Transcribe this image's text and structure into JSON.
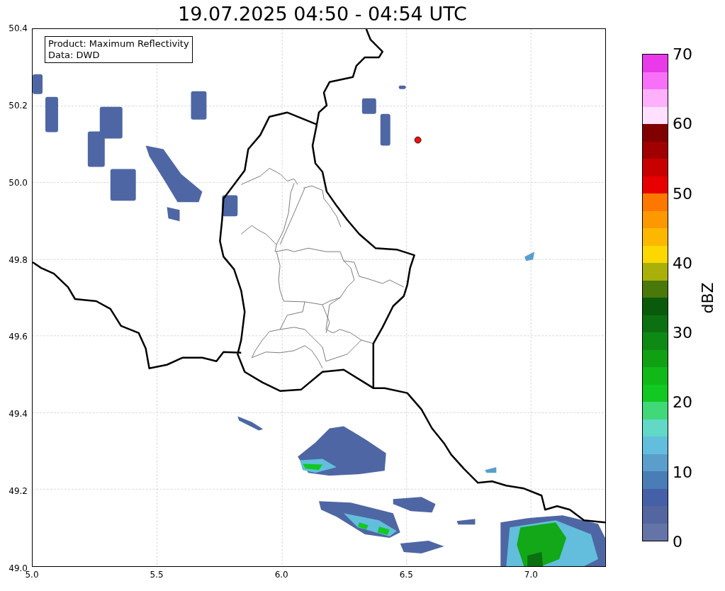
{
  "title": "19.07.2025 04:50 - 04:54 UTC",
  "info_box": {
    "lines": [
      "Product: Maximum Reflectivity",
      "Data: DWD"
    ]
  },
  "y_ticks": [
    "50.4",
    "50.2",
    "50.0",
    "49.8",
    "49.6",
    "49.4",
    "49.2",
    "49.0"
  ],
  "x_ticks": [
    "5.0",
    "5.5",
    "6.0",
    "6.5",
    "7.0"
  ],
  "colorbar": {
    "label": "dBZ",
    "ticks": [
      "70",
      "60",
      "50",
      "40",
      "30",
      "20",
      "10",
      "0"
    ],
    "segments": [
      {
        "color": "#6474a6"
      },
      {
        "color": "#5466a0"
      },
      {
        "color": "#4560a6"
      },
      {
        "color": "#4a7cb6"
      },
      {
        "color": "#5a9ecb"
      },
      {
        "color": "#62bedc"
      },
      {
        "color": "#62d8c6"
      },
      {
        "color": "#40d878"
      },
      {
        "color": "#12c822"
      },
      {
        "color": "#10b818"
      },
      {
        "color": "#10a014"
      },
      {
        "color": "#0e8a14"
      },
      {
        "color": "#0c7012"
      },
      {
        "color": "#0a5a0c"
      },
      {
        "color": "#4a780a"
      },
      {
        "color": "#aab00a"
      },
      {
        "color": "#fcd800"
      },
      {
        "color": "#fcb800"
      },
      {
        "color": "#fc9800"
      },
      {
        "color": "#fc7800"
      },
      {
        "color": "#e80000"
      },
      {
        "color": "#c80000"
      },
      {
        "color": "#a00000"
      },
      {
        "color": "#800000"
      },
      {
        "color": "#ffe0ff"
      },
      {
        "color": "#ffb0fa"
      },
      {
        "color": "#f870f8"
      },
      {
        "color": "#e83ae8"
      }
    ]
  }
}
